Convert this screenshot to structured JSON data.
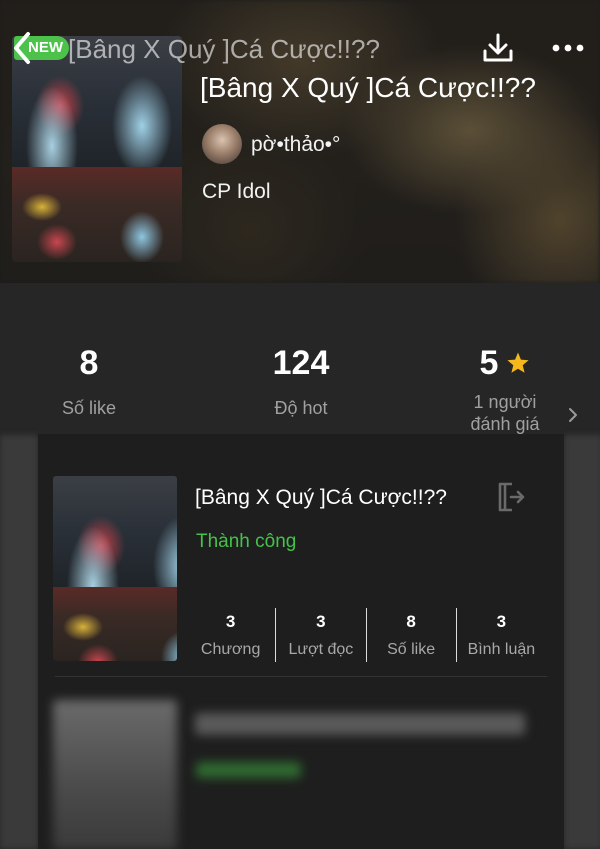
{
  "header": {
    "badge": "NEW",
    "title": "[Bâng X Quý ]Cá Cược!!??"
  },
  "book": {
    "title": "[Bâng X Quý ]Cá Cược!!??",
    "author": "pờ•thảo•°",
    "category": "CP Idol"
  },
  "stats": [
    {
      "value": "8",
      "label": "Số like"
    },
    {
      "value": "124",
      "label": "Độ hot"
    },
    {
      "value": "5",
      "label": "1 người\nđánh giá",
      "icon": "star-icon"
    }
  ],
  "items": [
    {
      "title": "[Bâng X Quý ]Cá Cược!!??",
      "status": "Thành công",
      "stats": [
        {
          "value": "3",
          "label": "Chương"
        },
        {
          "value": "3",
          "label": "Lượt đọc"
        },
        {
          "value": "8",
          "label": "Số like"
        },
        {
          "value": "3",
          "label": "Bình luận"
        }
      ]
    }
  ],
  "colors": {
    "accent_green": "#45c24a",
    "badge_green": "#4cc24a",
    "star": "#f5b81c",
    "background": "#262626"
  },
  "icons": [
    "back-icon",
    "download-icon",
    "more-icon",
    "star-icon",
    "chevron-right-icon",
    "exit-icon"
  ]
}
